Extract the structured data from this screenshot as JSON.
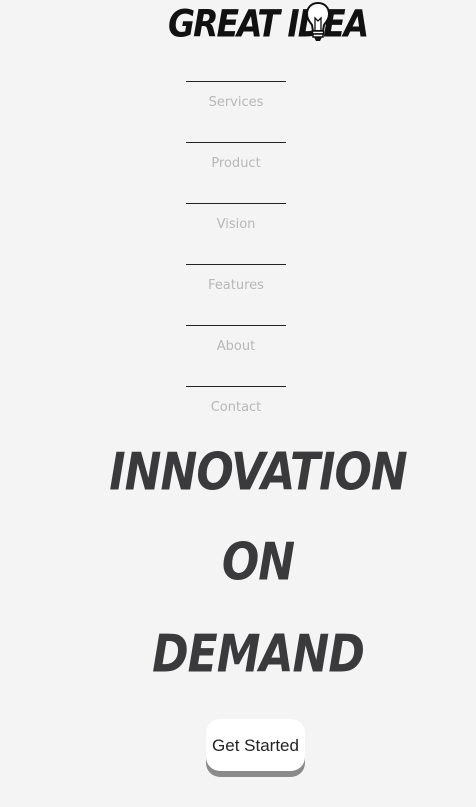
{
  "brand": {
    "name": "GREAT IDEA",
    "icon": "lightbulb-icon"
  },
  "nav": {
    "items": [
      {
        "label": "Services"
      },
      {
        "label": "Product"
      },
      {
        "label": "Vision"
      },
      {
        "label": "Features"
      },
      {
        "label": "About"
      },
      {
        "label": "Contact"
      }
    ]
  },
  "hero": {
    "line1": "INNOVATION",
    "line2": "ON",
    "line3": "DEMAND",
    "cta_label": "Get Started"
  },
  "colors": {
    "background": "#f4f4f4",
    "hero_text": "#3a3a3c",
    "nav_text": "#b8b8b8",
    "divider": "#222222",
    "button_bg": "#ffffff",
    "button_shadow": "#8a8a8a"
  }
}
